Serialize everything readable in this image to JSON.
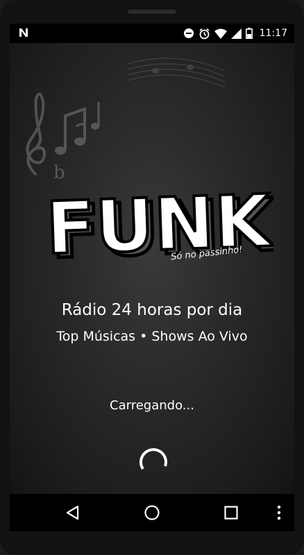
{
  "status_bar": {
    "time": "11:17",
    "icons": [
      "notification-n-icon",
      "do-not-disturb-icon",
      "alarm-icon",
      "wifi-icon",
      "signal-icon",
      "battery-icon"
    ]
  },
  "splash": {
    "logo_text": "FUNK",
    "tagline": "Só no passinho!",
    "line1": "Rádio 24 horas por dia",
    "line2": "Top Músicas • Shows Ao Vivo",
    "loading_text": "Carregando..."
  },
  "nav_bar": {
    "buttons": [
      "back-icon",
      "home-icon",
      "recents-icon",
      "more-icon"
    ]
  },
  "colors": {
    "background": "#2a2a2a",
    "text": "#ffffff",
    "bar": "#000000"
  }
}
